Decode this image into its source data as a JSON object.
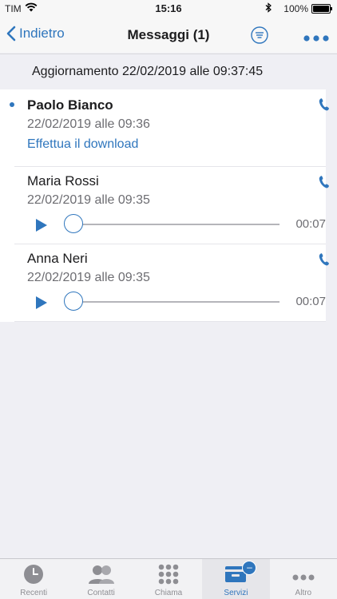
{
  "status_bar": {
    "carrier": "TIM",
    "time": "15:16",
    "battery": "100%"
  },
  "nav": {
    "back_label": "Indietro",
    "title": "Messaggi (1)"
  },
  "update_banner": "Aggiornamento 22/02/2019 alle 09:37:45",
  "messages": [
    {
      "name": "Paolo Bianco",
      "date": "22/02/2019 alle 09:36",
      "download_label": "Effettua il download",
      "unread": true
    },
    {
      "name": "Maria Rossi",
      "date": "22/02/2019 alle 09:35",
      "duration": "00:07",
      "progress": 0
    },
    {
      "name": "Anna Neri",
      "date": "22/02/2019 alle 09:35",
      "duration": "00:07",
      "progress": 0
    }
  ],
  "tabs": [
    {
      "label": "Recenti",
      "icon": "clock-icon"
    },
    {
      "label": "Contatti",
      "icon": "contacts-icon"
    },
    {
      "label": "Chiama",
      "icon": "keypad-icon"
    },
    {
      "label": "Servizi",
      "icon": "services-icon",
      "active": true,
      "badge": "–"
    },
    {
      "label": "Altro",
      "icon": "more-icon"
    }
  ],
  "colors": {
    "accent": "#2f76bd",
    "background": "#efeff4"
  }
}
